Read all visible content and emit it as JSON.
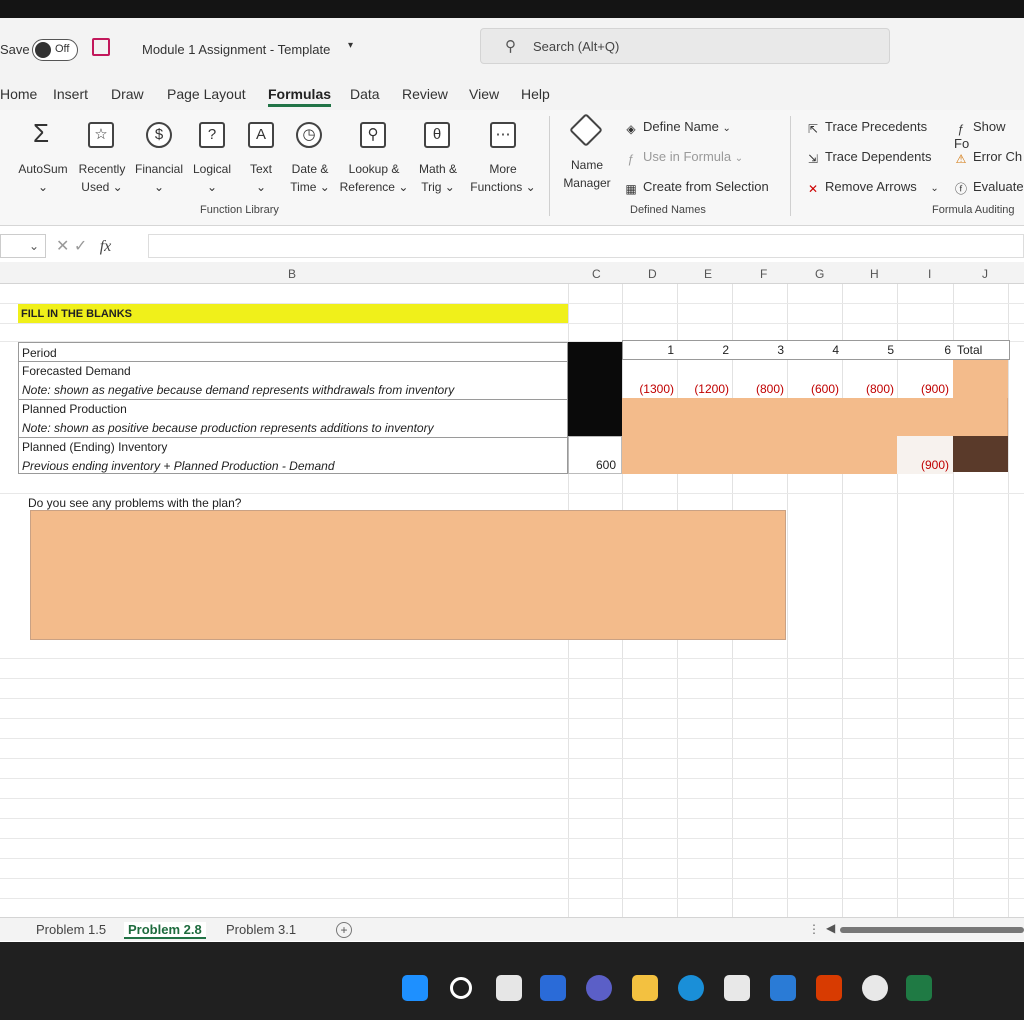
{
  "titlebar": {
    "autosave_label": "Save",
    "toggle_state": "Off",
    "doc_title": "Module 1 Assignment - Template",
    "search_placeholder": "Search (Alt+Q)"
  },
  "ribbon_tabs": [
    "Home",
    "Insert",
    "Draw",
    "Page Layout",
    "Formulas",
    "Data",
    "Review",
    "View",
    "Help"
  ],
  "active_tab": "Formulas",
  "ribbon": {
    "autosum": "AutoSum",
    "recently_used_1": "Recently",
    "recently_used_2": "Used",
    "financial": "Financial",
    "logical": "Logical",
    "text": "Text",
    "date_time_1": "Date &",
    "date_time_2": "Time",
    "lookup_1": "Lookup &",
    "lookup_2": "Reference",
    "math_1": "Math &",
    "math_2": "Trig",
    "more_1": "More",
    "more_2": "Functions",
    "function_library": "Function Library",
    "name_manager_1": "Name",
    "name_manager_2": "Manager",
    "define_name": "Define Name",
    "use_in_formula": "Use in Formula",
    "create_from_selection": "Create from Selection",
    "defined_names": "Defined Names",
    "trace_precedents": "Trace Precedents",
    "trace_dependents": "Trace Dependents",
    "remove_arrows": "Remove Arrows",
    "show_formulas": "Show Fo",
    "error_checking": "Error Ch",
    "evaluate": "Evaluate",
    "formula_auditing": "Formula Auditing"
  },
  "formula_bar": {
    "fx": "fx"
  },
  "columns": [
    "B",
    "C",
    "D",
    "E",
    "F",
    "G",
    "H",
    "I",
    "J"
  ],
  "sheet": {
    "banner": "FILL IN THE BLANKS",
    "row_period": "Period",
    "row_demand": "Forecasted Demand",
    "note_demand": "Note: shown as negative because demand represents withdrawals from inventory",
    "row_production": "Planned Production",
    "note_production": "Note: shown as positive because production represents additions to inventory",
    "row_inventory": "Planned (Ending) Inventory",
    "note_inventory": "Previous ending inventory + Planned Production - Demand",
    "starting_inventory": "600",
    "periods": [
      "1",
      "2",
      "3",
      "4",
      "5",
      "6"
    ],
    "total_label": "Total",
    "demand": [
      "(1300)",
      "(1200)",
      "(800)",
      "(600)",
      "(800)",
      "(900)"
    ],
    "ending_inventory_last": "(900)",
    "question": "Do you see any problems with the plan?"
  },
  "sheet_tabs": [
    "Problem 1.5",
    "Problem 2.8",
    "Problem 3.1"
  ],
  "active_sheet": "Problem 2.8",
  "colors": {
    "accent": "#217346",
    "fill_orange": "#f3bb8b",
    "banner_yellow": "#f0f01a"
  }
}
